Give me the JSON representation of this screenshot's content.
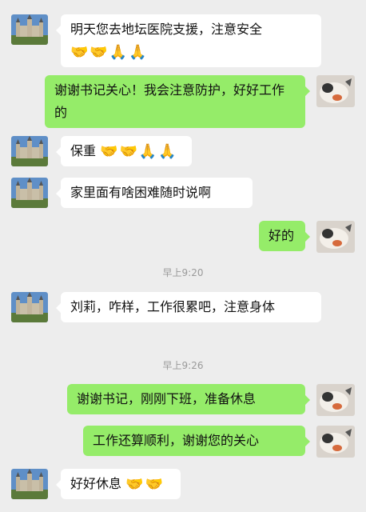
{
  "messages": [
    {
      "side": "in",
      "text": "明天您去地坛医院支援，注意安全",
      "emoji": "🤝🤝🙏🙏"
    },
    {
      "side": "out",
      "text": "谢谢书记关心！我会注意防护，好好工作的"
    },
    {
      "side": "in",
      "text": "保重",
      "emoji": "🤝🤝🙏🙏"
    },
    {
      "side": "in",
      "text": "家里面有啥困难随时说啊"
    },
    {
      "side": "out",
      "text": "好的"
    },
    {
      "side": "time",
      "text": "早上9:20"
    },
    {
      "side": "in",
      "text": "刘莉，咋样，工作很累吧，注意身体"
    },
    {
      "side": "time",
      "text": "早上9:26"
    },
    {
      "side": "out",
      "text": "谢谢书记，刚刚下班，准备休息"
    },
    {
      "side": "out",
      "text": "工作还算顺利，谢谢您的关心"
    },
    {
      "side": "in",
      "text": "好好休息",
      "emoji": "🤝🤝"
    }
  ],
  "colors": {
    "background": "#ededed",
    "incoming_bubble": "#ffffff",
    "outgoing_bubble": "#95ec69"
  },
  "icons": {
    "incoming_avatar": "castle-avatar",
    "outgoing_avatar": "cat-avatar"
  }
}
